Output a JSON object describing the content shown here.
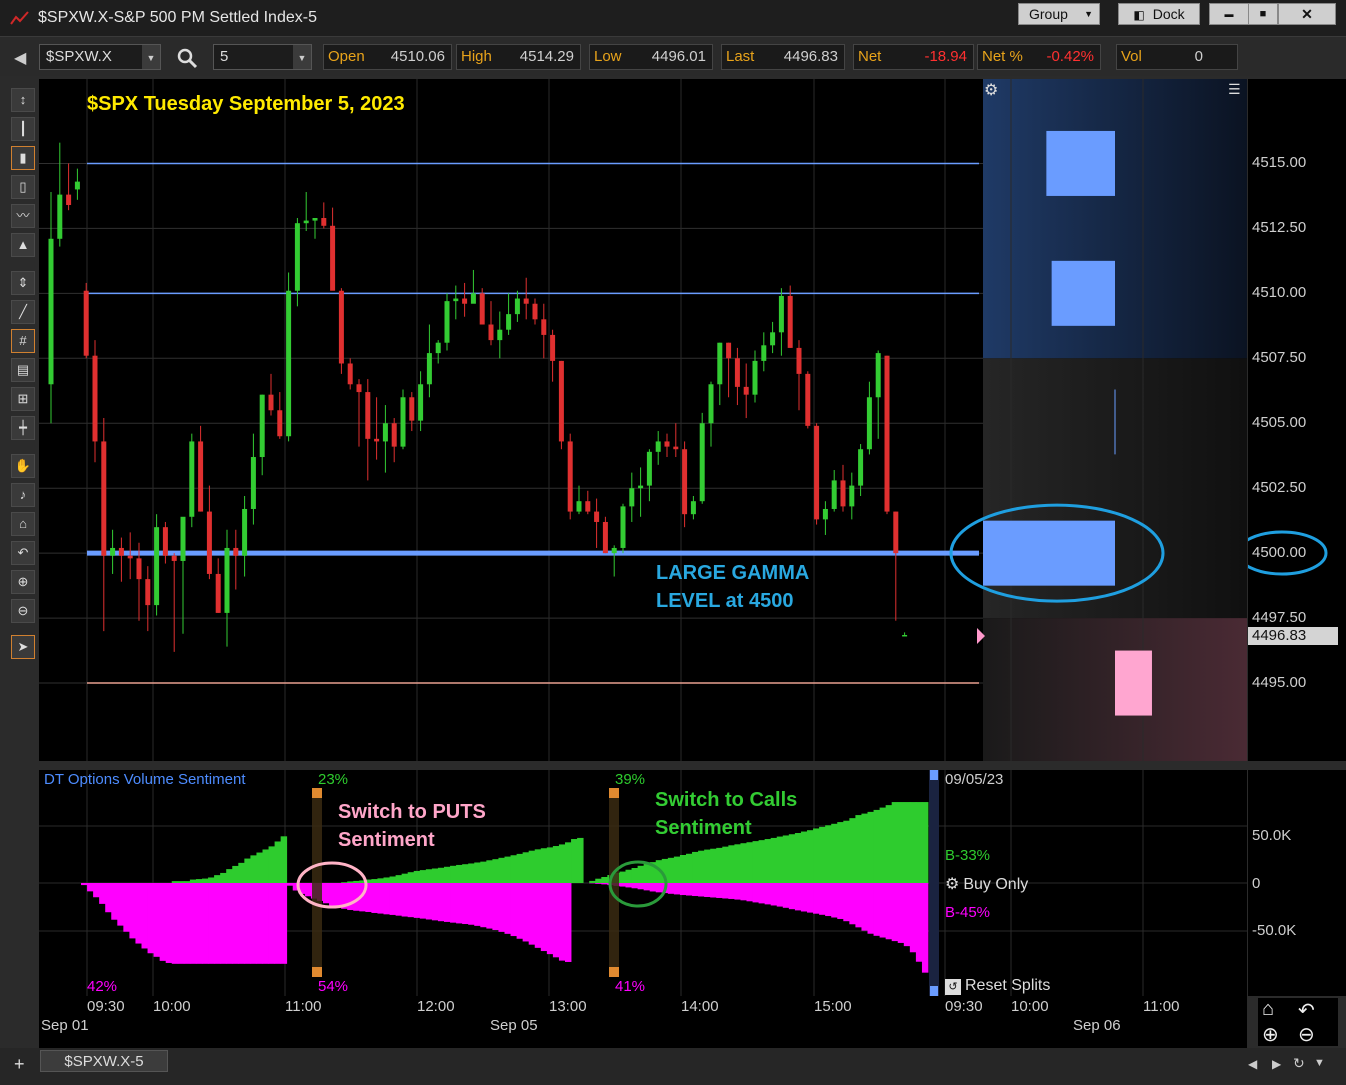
{
  "window": {
    "title": "$SPXW.X-S&P 500 PM Settled Index-5",
    "group_label": "Group",
    "dock_label": "Dock",
    "min_glyph": "▬",
    "max_glyph": "■",
    "close_glyph": "✕"
  },
  "toolbar": {
    "symbol": "$SPXW.X",
    "interval": "5",
    "quotes": [
      {
        "label": "Open",
        "value": "4510.06"
      },
      {
        "label": "High",
        "value": "4514.29"
      },
      {
        "label": "Low",
        "value": "4496.01"
      },
      {
        "label": "Last",
        "value": "4496.83"
      },
      {
        "label": "Net",
        "value": "-18.94"
      },
      {
        "label": "Net %",
        "value": "-0.42%"
      },
      {
        "label": "Vol",
        "value": "0"
      }
    ]
  },
  "colors": {
    "up": "#33cc33",
    "down": "#e03030",
    "level_line": "#6a9cff",
    "callout": "#29a8e0",
    "positive_hist": "#2ecc2e",
    "negative_hist": "#ff00ff",
    "title_text": "#ffea00"
  },
  "chart_data": [
    {
      "type": "candlestick",
      "title": "$SPX Tuesday September 5, 2023",
      "yticks": [
        "4515.00",
        "4512.50",
        "4510.00",
        "4507.50",
        "4505.00",
        "4502.50",
        "4500.00",
        "4497.50",
        "4495.00"
      ],
      "ylim": [
        4492.0,
        4518.25
      ],
      "last_price_label": "4496.83",
      "horizontal_levels": [
        4515.0,
        4510.0,
        4500.0,
        4495.0
      ],
      "annotation": [
        "LARGE GAMMA",
        "LEVEL at 4500"
      ],
      "gamma_blocks": [
        {
          "level": 4515.0,
          "side": "call",
          "size": 0.52
        },
        {
          "level": 4510.0,
          "side": "call",
          "size": 0.48
        },
        {
          "level": 4500.0,
          "side": "call",
          "size": 1.0
        },
        {
          "level": 4495.0,
          "side": "put",
          "size": 0.28
        }
      ],
      "candles": [
        [
          4506.5,
          4513.9,
          4505.0,
          4512.1
        ],
        [
          4512.1,
          4515.8,
          4511.8,
          4513.8
        ],
        [
          4513.8,
          4515.0,
          4513.2,
          4513.4
        ],
        [
          4514.0,
          4514.8,
          4513.6,
          4514.3
        ],
        [
          4510.1,
          4510.4,
          4507.5,
          4507.6
        ],
        [
          4507.6,
          4508.2,
          4503.5,
          4504.3
        ],
        [
          4504.3,
          4505.2,
          4497.0,
          4499.9
        ],
        [
          4499.9,
          4500.9,
          4499.2,
          4500.2
        ],
        [
          4500.2,
          4500.6,
          4498.9,
          4499.9
        ],
        [
          4499.9,
          4500.8,
          4499.0,
          4499.8
        ],
        [
          4499.8,
          4500.4,
          4497.4,
          4499.0
        ],
        [
          4499.0,
          4499.5,
          4497.0,
          4498.0
        ],
        [
          4498.0,
          4501.5,
          4497.6,
          4501.0
        ],
        [
          4501.0,
          4501.2,
          4499.6,
          4499.9
        ],
        [
          4499.9,
          4500.0,
          4496.2,
          4499.7
        ],
        [
          4499.7,
          4500.5,
          4496.9,
          4501.4
        ],
        [
          4501.4,
          4504.6,
          4501.0,
          4504.3
        ],
        [
          4504.3,
          4504.9,
          4501.6,
          4501.6
        ],
        [
          4501.6,
          4502.6,
          4499.0,
          4499.2
        ],
        [
          4499.2,
          4499.8,
          4497.7,
          4497.7
        ],
        [
          4497.7,
          4500.9,
          4496.4,
          4500.2
        ],
        [
          4500.2,
          4500.9,
          4498.6,
          4499.9
        ],
        [
          4499.9,
          4502.2,
          4499.1,
          4501.7
        ],
        [
          4501.7,
          4504.6,
          4501.1,
          4503.7
        ],
        [
          4503.7,
          4506.1,
          4503.0,
          4506.1
        ],
        [
          4506.1,
          4506.9,
          4505.3,
          4505.5
        ],
        [
          4505.5,
          4506.2,
          4504.4,
          4504.5
        ],
        [
          4504.5,
          4510.8,
          4504.3,
          4510.1
        ],
        [
          4510.1,
          4512.9,
          4509.5,
          4512.7
        ],
        [
          4512.7,
          4513.9,
          4512.4,
          4512.8
        ],
        [
          4512.8,
          4512.9,
          4512.1,
          4512.9
        ],
        [
          4512.9,
          4513.5,
          4512.5,
          4512.6
        ],
        [
          4512.6,
          4513.3,
          4510.2,
          4510.1
        ],
        [
          4510.1,
          4510.2,
          4506.9,
          4507.3
        ],
        [
          4507.3,
          4507.5,
          4506.3,
          4506.5
        ],
        [
          4506.5,
          4506.7,
          4504.1,
          4506.2
        ],
        [
          4506.2,
          4506.7,
          4502.8,
          4504.4
        ],
        [
          4504.4,
          4506.0,
          4503.6,
          4504.3
        ],
        [
          4504.3,
          4505.7,
          4503.1,
          4505.0
        ],
        [
          4505.0,
          4505.2,
          4503.5,
          4504.1
        ],
        [
          4504.1,
          4506.3,
          4504.0,
          4506.0
        ],
        [
          4506.0,
          4506.2,
          4504.7,
          4505.1
        ],
        [
          4505.1,
          4507.0,
          4504.7,
          4506.5
        ],
        [
          4506.5,
          4508.8,
          4506.0,
          4507.7
        ],
        [
          4507.7,
          4508.2,
          4507.3,
          4508.1
        ],
        [
          4508.1,
          4510.0,
          4507.8,
          4509.7
        ],
        [
          4509.7,
          4510.3,
          4509.0,
          4509.8
        ],
        [
          4509.8,
          4510.4,
          4509.1,
          4509.6
        ],
        [
          4509.6,
          4510.9,
          4509.7,
          4510.0
        ],
        [
          4510.0,
          4510.2,
          4508.8,
          4508.8
        ],
        [
          4508.8,
          4509.7,
          4508.0,
          4508.2
        ],
        [
          4508.2,
          4509.3,
          4507.5,
          4508.6
        ],
        [
          4508.6,
          4510.0,
          4508.4,
          4509.2
        ],
        [
          4509.2,
          4510.1,
          4508.9,
          4509.8
        ],
        [
          4509.8,
          4510.6,
          4509.0,
          4509.6
        ],
        [
          4509.6,
          4509.8,
          4508.8,
          4509.0
        ],
        [
          4509.0,
          4509.6,
          4507.5,
          4508.4
        ],
        [
          4508.4,
          4508.6,
          4506.6,
          4507.4
        ],
        [
          4507.4,
          4507.4,
          4504.0,
          4504.3
        ],
        [
          4504.3,
          4504.6,
          4501.3,
          4501.6
        ],
        [
          4501.6,
          4502.6,
          4501.5,
          4502.0
        ],
        [
          4502.0,
          4502.4,
          4501.5,
          4501.6
        ],
        [
          4501.6,
          4502.1,
          4500.2,
          4501.2
        ],
        [
          4501.2,
          4501.4,
          4500.0,
          4500.0
        ],
        [
          4500.0,
          4500.3,
          4499.1,
          4500.2
        ],
        [
          4500.2,
          4501.9,
          4500.0,
          4501.8
        ],
        [
          4501.8,
          4503.1,
          4501.2,
          4502.5
        ],
        [
          4502.5,
          4503.3,
          4501.4,
          4502.6
        ],
        [
          4502.6,
          4504.0,
          4502.0,
          4503.9
        ],
        [
          4503.9,
          4504.7,
          4503.4,
          4504.3
        ],
        [
          4504.3,
          4504.6,
          4503.7,
          4504.1
        ],
        [
          4504.1,
          4505.0,
          4503.7,
          4504.0
        ],
        [
          4504.0,
          4504.3,
          4501.0,
          4501.5
        ],
        [
          4501.5,
          4502.2,
          4501.3,
          4502.0
        ],
        [
          4502.0,
          4505.4,
          4501.9,
          4505.0
        ],
        [
          4505.0,
          4506.6,
          4504.1,
          4506.5
        ],
        [
          4506.5,
          4508.1,
          4505.7,
          4508.1
        ],
        [
          4508.1,
          4508.1,
          4506.0,
          4507.5
        ],
        [
          4507.5,
          4507.9,
          4505.7,
          4506.4
        ],
        [
          4506.4,
          4507.3,
          4505.2,
          4506.1
        ],
        [
          4506.1,
          4507.8,
          4505.8,
          4507.4
        ],
        [
          4507.4,
          4508.5,
          4507.0,
          4508.0
        ],
        [
          4508.0,
          4508.9,
          4507.7,
          4508.5
        ],
        [
          4508.5,
          4510.2,
          4507.6,
          4509.9
        ],
        [
          4509.9,
          4510.3,
          4507.9,
          4507.9
        ],
        [
          4507.9,
          4508.2,
          4505.5,
          4506.9
        ],
        [
          4506.9,
          4507.0,
          4504.8,
          4504.9
        ],
        [
          4504.9,
          4505.0,
          4501.1,
          4501.3
        ],
        [
          4501.3,
          4502.0,
          4500.7,
          4501.7
        ],
        [
          4501.7,
          4503.2,
          4501.6,
          4502.8
        ],
        [
          4502.8,
          4503.4,
          4501.6,
          4501.8
        ],
        [
          4501.8,
          4503.1,
          4501.3,
          4502.6
        ],
        [
          4502.6,
          4504.2,
          4502.2,
          4504.0
        ],
        [
          4504.0,
          4506.6,
          4503.8,
          4506.0
        ],
        [
          4506.0,
          4507.8,
          4504.4,
          4507.7
        ],
        [
          4507.6,
          4507.6,
          4501.5,
          4501.6
        ],
        [
          4501.6,
          4501.6,
          4497.4,
          4500.0
        ],
        [
          4496.83,
          4496.95,
          4496.81,
          4496.85
        ]
      ]
    },
    {
      "type": "bar",
      "title": "DT Options Volume Sentiment",
      "yticks": [
        "50.0K",
        "0",
        "-50.0K"
      ],
      "ylim": [
        -92000,
        92000
      ],
      "date_label": "09/05/23",
      "buy_label": "B-33%",
      "sell_label": "B-45%",
      "setting_label": "Buy Only",
      "reset_label": "Reset Splits",
      "split_percentages": [
        {
          "top": "23%",
          "bottom": "54%"
        },
        {
          "top": "39%",
          "bottom": "41%"
        }
      ],
      "corner_percent": "42%",
      "annotations": [
        [
          "Switch to PUTS",
          "Sentiment"
        ],
        [
          "Switch to Calls",
          "Sentiment"
        ]
      ],
      "positive": [
        0,
        0,
        0,
        0,
        0,
        0,
        0,
        0,
        0,
        0,
        0,
        0,
        0,
        0,
        0,
        1500,
        1500,
        1500,
        2800,
        3200,
        3600,
        4500,
        6400,
        8200,
        11300,
        13900,
        16400,
        19900,
        22500,
        24800,
        27300,
        29800,
        33800,
        38000,
        0,
        0,
        0,
        0,
        0,
        0,
        0,
        0,
        0,
        600,
        1300,
        1700,
        2100,
        2800,
        3200,
        3800,
        4500,
        5300,
        6400,
        7600,
        8800,
        9800,
        10500,
        11200,
        11800,
        12400,
        13200,
        14000,
        14700,
        15300,
        15900,
        16700,
        17400,
        18500,
        19400,
        20500,
        21500,
        22600,
        23700,
        25000,
        26300,
        27400,
        28300,
        29000,
        30100,
        31400,
        33100,
        35800,
        36700,
        0,
        1700,
        3500,
        4900,
        6500,
        8200,
        9300,
        10800,
        12200,
        14000,
        15600,
        17000,
        18600,
        19600,
        20500,
        21500,
        22800,
        23800,
        25300,
        26300,
        27200,
        27900,
        28600,
        29600,
        30700,
        31500,
        32400,
        33200,
        34100,
        34900,
        35800,
        36700,
        37800,
        38700,
        39700,
        40700,
        41900,
        43000,
        44400,
        45700,
        47000,
        48200,
        49600,
        50700,
        52800,
        55300,
        56500,
        57900,
        59500,
        61400,
        63400,
        65900,
        65900,
        65900,
        65900,
        65900,
        65900
      ],
      "negative": [
        -1700,
        -6800,
        -11600,
        -17000,
        -23800,
        -29900,
        -34700,
        -39700,
        -45100,
        -49300,
        -53300,
        -57200,
        -60100,
        -63400,
        -65100,
        -65800,
        -65800,
        -65800,
        -65800,
        -65800,
        -65800,
        -65800,
        -65800,
        -65800,
        -65800,
        -65800,
        -65800,
        -65800,
        -65800,
        -65800,
        -65800,
        -65800,
        -65800,
        -65800,
        -2200,
        -6100,
        -8900,
        -10800,
        -12700,
        -14600,
        -16500,
        -18400,
        -20000,
        -21000,
        -22000,
        -22600,
        -23100,
        -23600,
        -24400,
        -24900,
        -25500,
        -26000,
        -26600,
        -27300,
        -27800,
        -28400,
        -29000,
        -29700,
        -30400,
        -31100,
        -31700,
        -32300,
        -32900,
        -33400,
        -34000,
        -34900,
        -36000,
        -37100,
        -38300,
        -39800,
        -41400,
        -43200,
        -45400,
        -47600,
        -50200,
        -52800,
        -55400,
        -57900,
        -60500,
        -63200,
        -64300,
        0,
        0,
        0,
        -300,
        -700,
        -1100,
        -1700,
        -2400,
        -2900,
        -3600,
        -4300,
        -5100,
        -6000,
        -6900,
        -7600,
        -8200,
        -8800,
        -9300,
        -9800,
        -10200,
        -10600,
        -11000,
        -11400,
        -11800,
        -12200,
        -12600,
        -13000,
        -13500,
        -14100,
        -14900,
        -15800,
        -16600,
        -17400,
        -18300,
        -19200,
        -20200,
        -21300,
        -22300,
        -23200,
        -24100,
        -25000,
        -25900,
        -26900,
        -28100,
        -29300,
        -31100,
        -33600,
        -36100,
        -38800,
        -41300,
        -43000,
        -44400,
        -45800,
        -47300,
        -48800,
        -51400,
        -56400,
        -64100,
        -73000
      ]
    }
  ],
  "xaxis": {
    "time_labels": [
      "09:30",
      "10:00",
      "11:00",
      "12:00",
      "13:00",
      "14:00",
      "15:00",
      "09:30",
      "10:00",
      "11:00"
    ],
    "date_labels": [
      "Sep 01",
      "Sep 05",
      "Sep 06"
    ]
  },
  "statusbar": {
    "tab_label": "$SPXW.X-5",
    "add_glyph": "+"
  }
}
